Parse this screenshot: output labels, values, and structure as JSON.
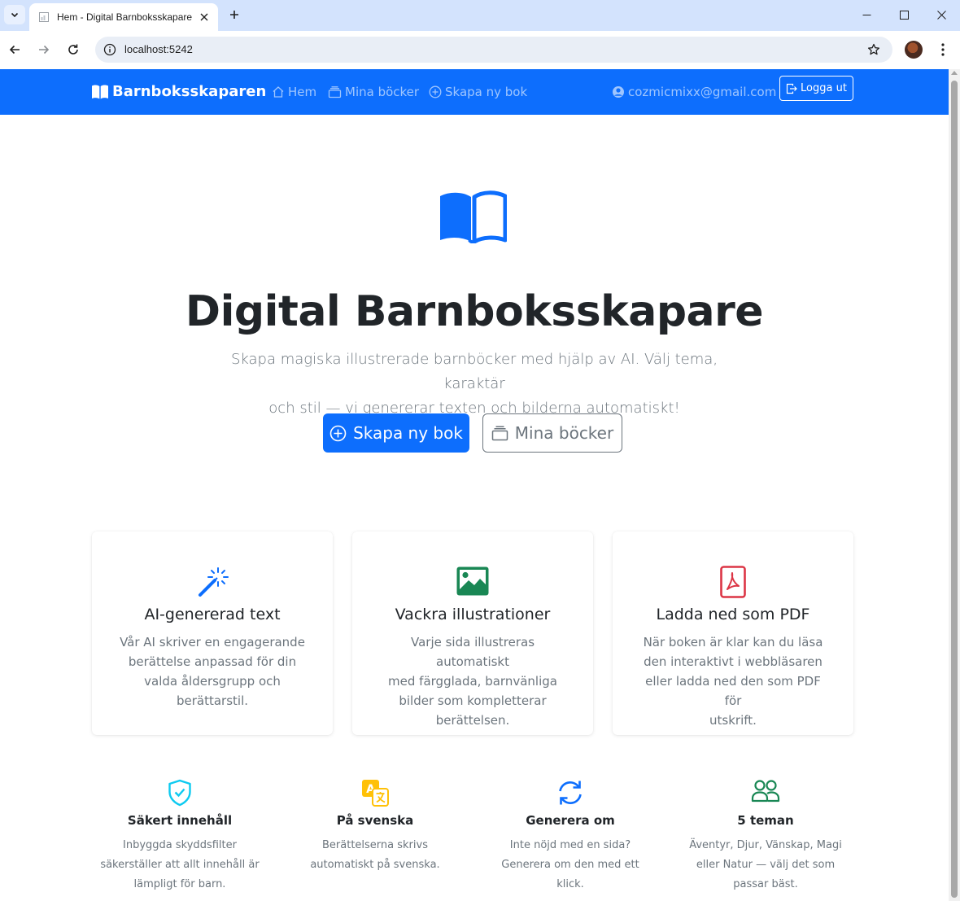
{
  "browser": {
    "tab_title": "Hem - Digital Barnboksskapare",
    "url": "localhost:5242"
  },
  "navbar": {
    "brand": "Barnboksskaparen",
    "links": [
      {
        "label": "Hem",
        "icon": "house-icon"
      },
      {
        "label": "Mina böcker",
        "icon": "collection-icon"
      },
      {
        "label": "Skapa ny bok",
        "icon": "plus-circle-icon"
      }
    ],
    "user_email": "cozmicmixx@gmail.com",
    "logout_label": "Logga ut"
  },
  "hero": {
    "icon": "book-icon",
    "title": "Digital Barnboksskapare",
    "lead_line1": "Skapa magiska illustrerade barnböcker med hjälp av AI. Välj tema, karaktär",
    "lead_line2": "och stil — vi genererar texten och bilderna automatiskt!",
    "primary_button": "Skapa ny bok",
    "secondary_button": "Mina böcker"
  },
  "cards": [
    {
      "icon": "magic-wand-icon",
      "title": "AI-genererad text",
      "lines": [
        "Vår AI skriver en engagerande",
        "berättelse anpassad för din",
        "valda åldersgrupp och",
        "berättarstil."
      ]
    },
    {
      "icon": "image-icon",
      "title": "Vackra illustrationer",
      "lines": [
        "Varje sida illustreras automatiskt",
        "med färgglada, barnvänliga",
        "bilder som kompletterar",
        "berättelsen."
      ]
    },
    {
      "icon": "pdf-icon",
      "title": "Ladda ned som PDF",
      "lines": [
        "När boken är klar kan du läsa",
        "den interaktivt i webbläsaren",
        "eller ladda ned den som PDF för",
        "utskrift."
      ]
    }
  ],
  "features": [
    {
      "icon": "shield-check-icon",
      "title": "Säkert innehåll",
      "lines": [
        "Inbyggda skyddsfilter",
        "säkerställer att allt innehåll är",
        "lämpligt för barn."
      ]
    },
    {
      "icon": "translate-icon",
      "title": "På svenska",
      "lines": [
        "Berättelserna skrivs",
        "automatiskt på svenska."
      ]
    },
    {
      "icon": "refresh-icon",
      "title": "Generera om",
      "lines": [
        "Inte nöjd med en sida?",
        "Generera om den med ett",
        "klick."
      ]
    },
    {
      "icon": "people-icon",
      "title": "5 teman",
      "lines": [
        "Äventyr, Djur, Vänskap, Magi",
        "eller Natur — välj det som",
        "passar bäst."
      ]
    }
  ],
  "colors": {
    "primary": "#0d6efd",
    "success": "#198754",
    "danger": "#dc3545",
    "info": "#0dcaf0",
    "warning": "#ffc107",
    "muted": "#6c757d"
  }
}
